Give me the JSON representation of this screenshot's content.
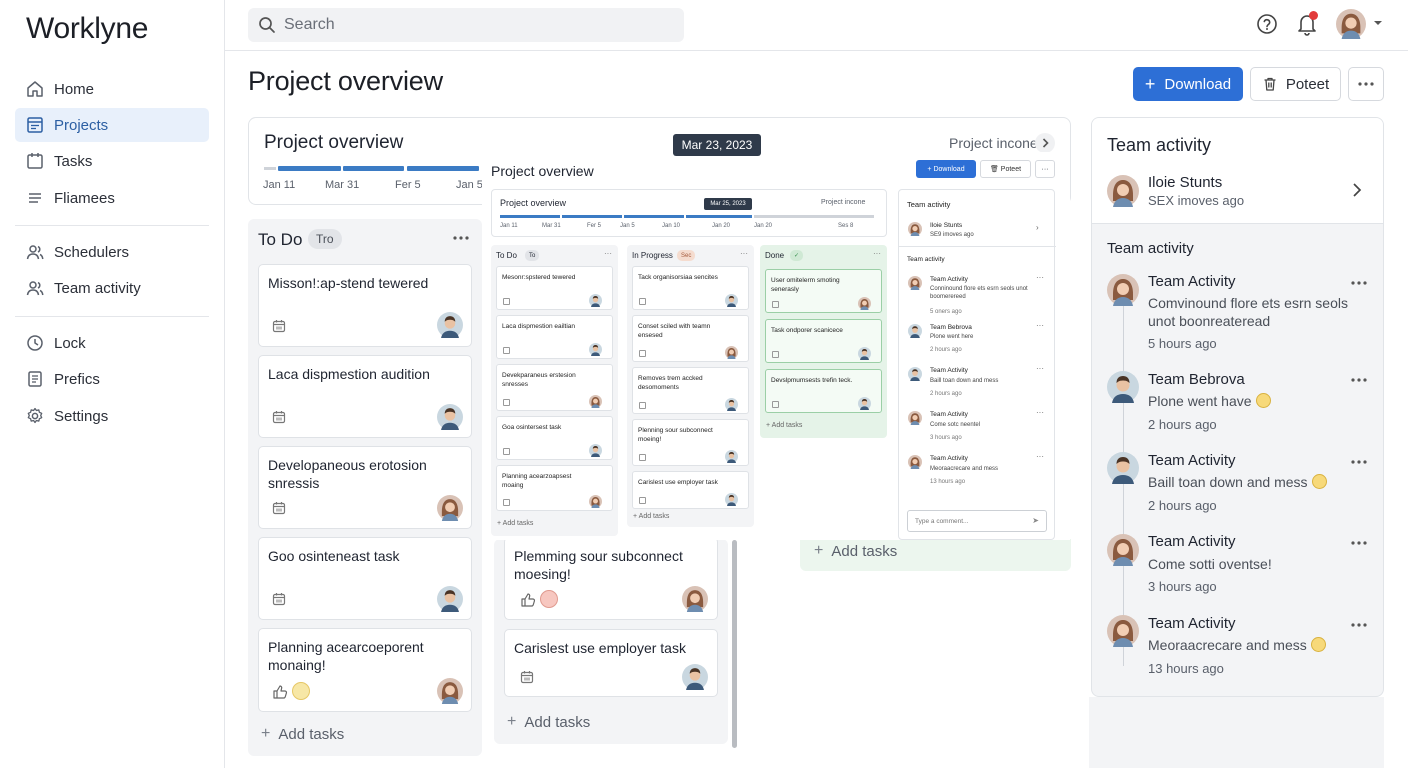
{
  "app": {
    "brand": "Worklyne"
  },
  "sidebar": {
    "items": [
      {
        "label": "Home",
        "icon": "home-icon"
      },
      {
        "label": "Projects",
        "icon": "projects-icon"
      },
      {
        "label": "Tasks",
        "icon": "tasks-icon"
      },
      {
        "label": "Fliamees",
        "icon": "list-icon"
      },
      {
        "label": "Schedulers",
        "icon": "users-icon"
      },
      {
        "label": "Team activity",
        "icon": "users-icon"
      },
      {
        "label": "Lock",
        "icon": "clock-icon"
      },
      {
        "label": "Prefics",
        "icon": "document-icon"
      },
      {
        "label": "Settings",
        "icon": "gear-icon"
      }
    ],
    "active": "Projects"
  },
  "search": {
    "placeholder": "Search"
  },
  "header": {
    "title": "Project overview",
    "download_label": "Download",
    "poteet_label": "Poteet"
  },
  "overview": {
    "title": "Project overview",
    "income_label": "Project incone",
    "timeline": [
      "Jan 11",
      "Mar 31",
      "Fer 5",
      "Jan 5"
    ],
    "date_tooltip": "Mar 23, 2023"
  },
  "todo": {
    "title": "To Do",
    "badge": "Tro",
    "cards": [
      {
        "title": "Misson!:ap-stend tewered"
      },
      {
        "title": "Laca dispmestion audition"
      },
      {
        "title": "Developaneous erotosion snressis"
      },
      {
        "title": "Goo osinteneast task"
      },
      {
        "title": "Planning acearcoeporent monaing!"
      }
    ],
    "add_label": "Add tasks"
  },
  "in_progress": {
    "cards": [
      {
        "title": "Plemming sour subconnect moesing!"
      },
      {
        "title": "Carislest use employer task"
      }
    ],
    "add_label": "Add tasks"
  },
  "done": {
    "add_label": "Add tasks"
  },
  "preview": {
    "title": "Project overview",
    "download_label": "Download",
    "poteet_label": "Poteet",
    "ov_title": "Project overview",
    "ov_income": "Project incone",
    "ov_tip": "Mar 25, 2023",
    "timeline": [
      "Jan 11",
      "Mar 31",
      "Fer 5",
      "Jan 5",
      "Jan 10",
      "Jan 20",
      "Jan 20",
      "Ses 8"
    ],
    "columns": [
      {
        "title": "To Do",
        "badge": "To",
        "cards": [
          "Mesonr:spstered tewered",
          "Laca dispmestion eailtian",
          "Devekparaneus erstesion snresses",
          "Goa osintersest task",
          "Planning acearzoapsest moaing"
        ],
        "add": "Add tasks"
      },
      {
        "title": "In Progress",
        "badge": "Sec",
        "cards": [
          "Tack organisorsiaa sencites",
          "Conset sciled with teamn ensesed",
          "Removes trem accked desomoments",
          "Plenning sour subconnect moeing!",
          "Carislest use employer task"
        ],
        "add": "Add tasks"
      },
      {
        "title": "Done",
        "badge": "✓",
        "cards": [
          "User omitelerm smoting senerasly",
          "Task ondporer scanicece",
          "Devslpmumsests trefin teck."
        ],
        "add": "Add tasks"
      }
    ],
    "team": {
      "title": "Team activity",
      "user_name": "Iloie Stunts",
      "user_sub": "SE9 imoves ago",
      "sub_title": "Team activity",
      "items": [
        {
          "name": "Team Activity",
          "text": "Conninound flore ets esrn seols unot boomerereed",
          "time": "5 oners ago"
        },
        {
          "name": "Team Bebrova",
          "text": "Plone went here",
          "time": "2 hours ago"
        },
        {
          "name": "Team Activity",
          "text": "Baill toan down and mess",
          "time": "2 hours ago"
        },
        {
          "name": "Team Activity",
          "text": "Come sotc neentel",
          "time": "3 hours ago"
        },
        {
          "name": "Team Activity",
          "text": "Meoraacrecare and mess",
          "time": "13 hours ago"
        }
      ],
      "comment_placeholder": "Type a comment..."
    }
  },
  "team_panel": {
    "title": "Team activity",
    "user": {
      "name": "Iloie Stunts",
      "subtitle": "SEX imoves ago"
    },
    "section_title": "Team activity",
    "activities": [
      {
        "name": "Team Activity",
        "text": "Comvinound flore ets esrn seols unot boonreateread",
        "time": "5 hours ago"
      },
      {
        "name": "Team Bebrova",
        "text": "Plone went have",
        "time": "2 hours ago"
      },
      {
        "name": "Team Activity",
        "text": "Baill toan down and mess",
        "time": "2 hours ago"
      },
      {
        "name": "Team Activity",
        "text": "Come sotti oventse!",
        "time": "3 hours ago"
      },
      {
        "name": "Team Activity",
        "text": "Meoraacrecare and mess",
        "time": "13 hours ago"
      }
    ]
  },
  "colors": {
    "accent": "#2d6fd6",
    "active_bg": "#e8f0fb",
    "timeline": "#3b7bc4",
    "done_bg": "#e5f3e8",
    "notification": "#e23b3b"
  }
}
